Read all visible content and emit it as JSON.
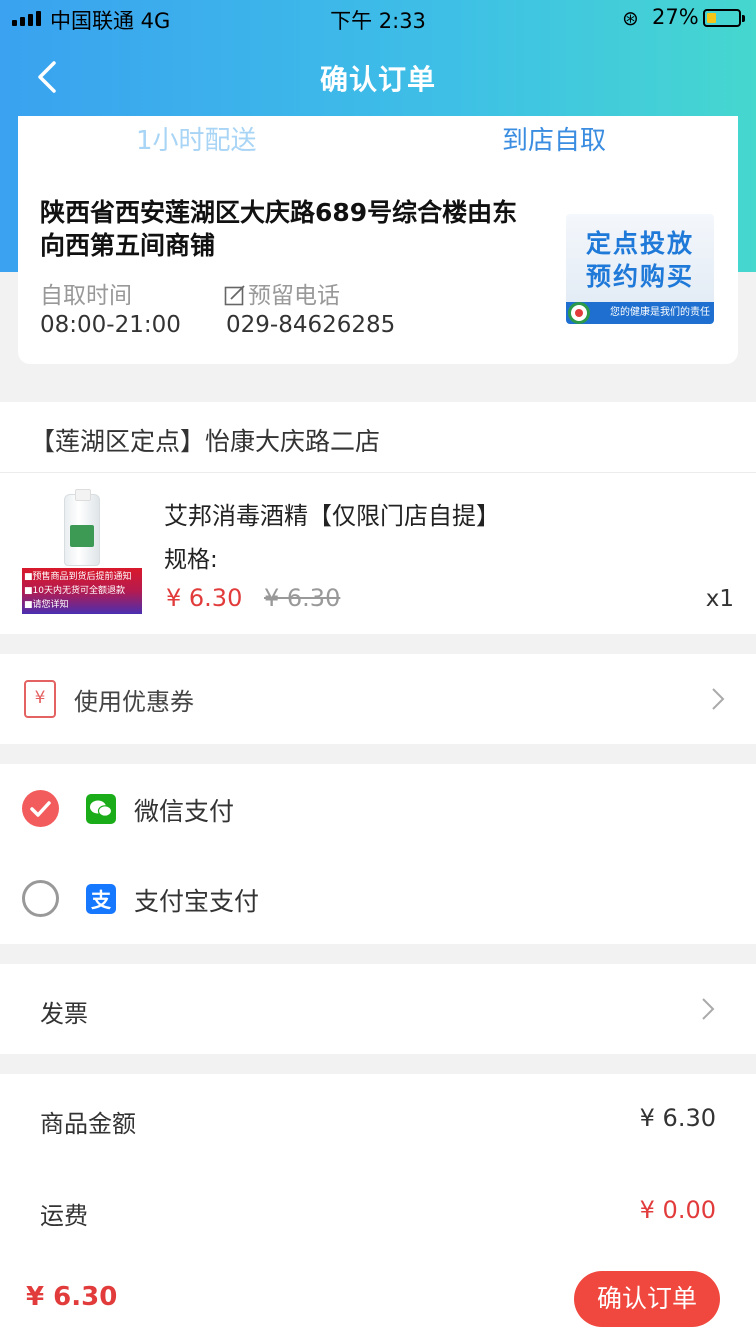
{
  "status_bar": {
    "carrier": "中国联通 4G",
    "time": "下午 2:33",
    "battery": "27%"
  },
  "nav": {
    "title": "确认订单"
  },
  "delivery": {
    "tabs": [
      "1小时配送",
      "到店自取"
    ],
    "active_tab": "到店自取",
    "address": "陕西省西安莲湖区大庆路689号综合楼由东向西第五间商铺",
    "pickup_time_label": "自取时间",
    "pickup_time": "08:00-21:00",
    "phone_label": "预留电话",
    "phone": "029-84626285"
  },
  "promo": {
    "line1": "定点投放",
    "line2": "预约购买",
    "tagline": "您的健康是我们的责任"
  },
  "store": {
    "name": "【莲湖区定点】怡康大庆路二店"
  },
  "product": {
    "name": "艾邦消毒酒精【仅限门店自提】",
    "spec_label": "规格:",
    "price": "¥ 6.30",
    "original_price": "¥ 6.30",
    "quantity": "x1",
    "notice": [
      "■预售商品到货后提前通知",
      "■10天内无货可全额退款",
      "■请您详知"
    ]
  },
  "coupon": {
    "label": "使用优惠券",
    "icon": "¥"
  },
  "payment": {
    "options": [
      {
        "label": "微信支付",
        "selected": true,
        "icon": "wechat-pay-icon"
      },
      {
        "label": "支付宝支付",
        "selected": false,
        "icon": "alipay-icon"
      }
    ]
  },
  "invoice": {
    "label": "发票"
  },
  "summary": {
    "goods_label": "商品金额",
    "goods_amount": "¥ 6.30",
    "shipping_label": "运费",
    "shipping_amount": "¥ 0.00"
  },
  "footer": {
    "total": "¥ 6.30",
    "confirm_label": "确认订单"
  },
  "colors": {
    "accent_red": "#e23b3b",
    "button_red": "#f0483e",
    "header_blue": "#3aa2f0",
    "header_teal": "#46d7cf",
    "wechat_green": "#1aad19",
    "alipay_blue": "#1677ff"
  }
}
